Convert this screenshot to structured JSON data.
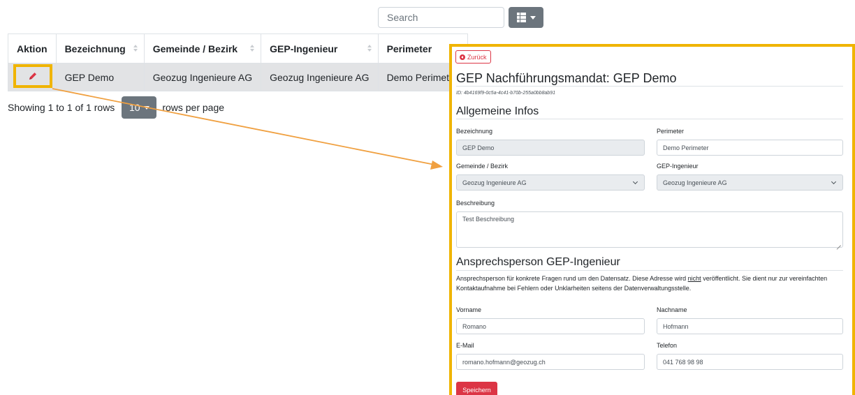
{
  "toolbar": {
    "search_placeholder": "Search",
    "columns_icon": "grid-icon"
  },
  "table": {
    "headers": [
      "Aktion",
      "Bezeichnung",
      "Gemeinde / Bezirk",
      "GEP-Ingenieur",
      "Perimeter"
    ],
    "rows": [
      {
        "action_icon": "pencil-icon",
        "bezeichnung": "GEP Demo",
        "gemeinde": "Geozug Ingenieure AG",
        "ingenieur": "Geozug Ingenieure AG",
        "perimeter": "Demo Perimeter"
      }
    ]
  },
  "pagination": {
    "showing": "Showing 1 to 1 of 1 rows",
    "page_size": "10",
    "rows_per_page": "rows per page"
  },
  "form": {
    "back_label": "Zurück",
    "title": "GEP Nachführungsmandat: GEP Demo",
    "id_line": "ID: 4b4169f9-0c5a-4c41-b70b-255a0bb8ab91",
    "section_general": "Allgemeine Infos",
    "bezeichnung_label": "Bezeichnung",
    "bezeichnung_value": "GEP Demo",
    "perimeter_label": "Perimeter",
    "perimeter_value": "Demo Perimeter",
    "gemeinde_label": "Gemeinde / Bezirk",
    "gemeinde_value": "Geozug Ingenieure AG",
    "ingenieur_label": "GEP-Ingenieur",
    "ingenieur_value": "Geozug Ingenieure AG",
    "beschreibung_label": "Beschreibung",
    "beschreibung_value": "Test Beschreibung",
    "section_contact": "Ansprechsperson GEP-Ingenieur",
    "help_before": "Ansprechsperson für konkrete Fragen rund um den Datensatz. Diese Adresse wird ",
    "help_emph": "nicht",
    "help_after": " veröffentlicht. Sie dient nur zur vereinfachten Kontaktaufnahme bei Fehlern oder Unklarheiten seitens der Datenverwaltungsstelle.",
    "vorname_label": "Vorname",
    "vorname_value": "Romano",
    "nachname_label": "Nachname",
    "nachname_value": "Hofmann",
    "email_label": "E-Mail",
    "email_value": "romano.hofmann@geozug.ch",
    "telefon_label": "Telefon",
    "telefon_value": "041 768 98 98",
    "save_label": "Speichern"
  },
  "colors": {
    "highlight": "#f0b400",
    "arrow": "#f0a040",
    "danger": "#dc3545",
    "secondary": "#6c757d"
  }
}
